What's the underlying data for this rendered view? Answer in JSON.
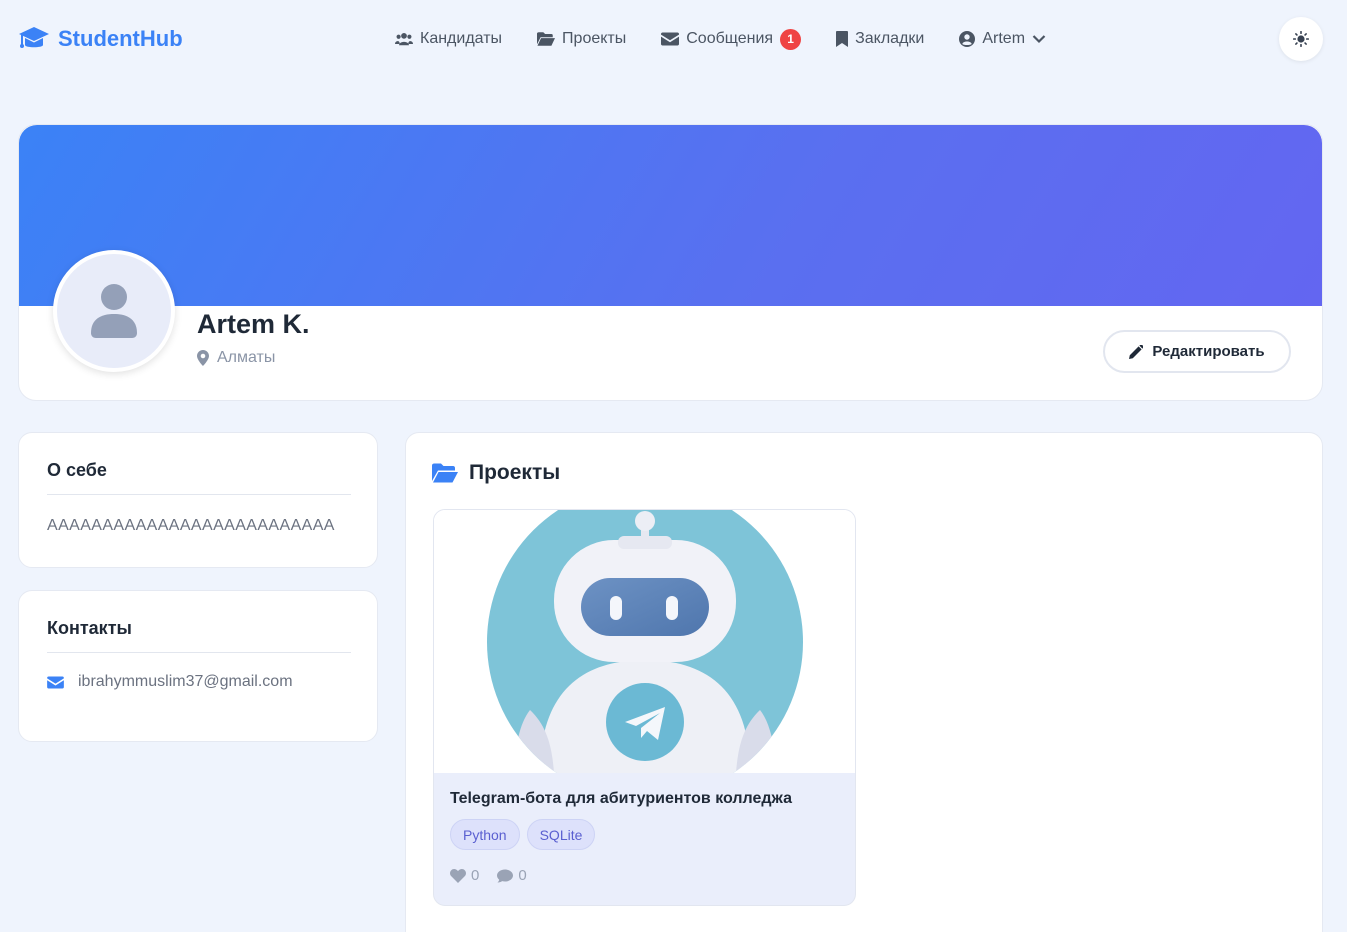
{
  "brand": {
    "name": "StudentHub"
  },
  "nav": {
    "items": [
      {
        "label": "Кандидаты",
        "icon": "users-icon"
      },
      {
        "label": "Проекты",
        "icon": "folder-open-icon"
      },
      {
        "label": "Сообщения",
        "icon": "envelope-icon",
        "badge": "1"
      },
      {
        "label": "Закладки",
        "icon": "bookmark-icon"
      }
    ],
    "user": {
      "label": "Artem",
      "icon": "user-circle-icon"
    }
  },
  "profile": {
    "name": "Artem K.",
    "location": "Алматы",
    "edit_label": "Редактировать"
  },
  "about": {
    "title": "О себе",
    "text": "AAAAAAAAAAAAAAAAAAAAAAAAAA"
  },
  "contacts": {
    "title": "Контакты",
    "email": "ibrahymmuslim37@gmail.com"
  },
  "projects": {
    "title": "Проекты",
    "items": [
      {
        "title": "Telegram-бота для абитуриентов колледжа",
        "tags": [
          "Python",
          "SQLite"
        ],
        "likes": "0",
        "comments": "0"
      }
    ]
  },
  "colors": {
    "accent": "#3b82f6",
    "cover_gradient_start": "#3b82f6",
    "cover_gradient_end": "#6366f1",
    "badge": "#ef4444",
    "tag_text": "#5a5fd0"
  }
}
